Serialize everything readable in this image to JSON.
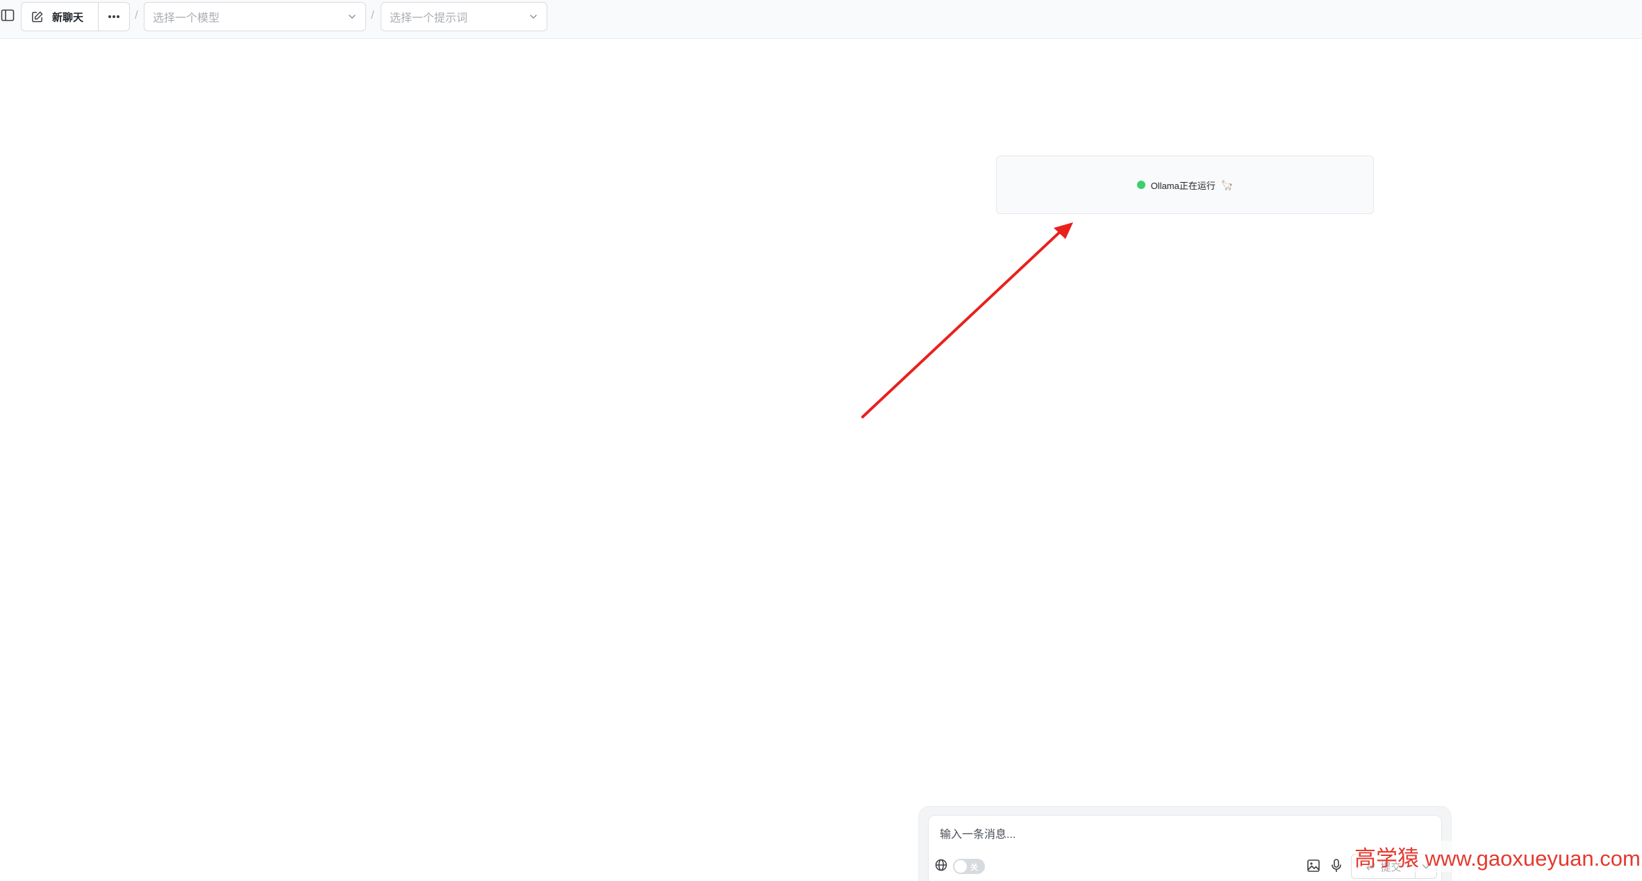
{
  "toolbar": {
    "new_chat_label": "新聊天",
    "separator": "/",
    "model_select": {
      "placeholder": "选择一个模型"
    },
    "prompt_select": {
      "placeholder": "选择一个提示词"
    }
  },
  "status": {
    "text": "Ollama正在运行",
    "emoji": "🦙",
    "dot_color": "#3ccf6e"
  },
  "composer": {
    "placeholder": "输入一条消息...",
    "web_search_toggle_label": "关",
    "web_search_enabled": false,
    "submit_label": "提交"
  },
  "watermark": {
    "text": "高学猿 www.gaoxueyuan.com"
  },
  "annotation": {
    "arrow_color": "#e8211d"
  },
  "icons": {
    "sidebar": "sidebar-toggle-icon",
    "new_chat": "edit-icon",
    "more": "more-horizontal-icon",
    "dropdown": "chevron-down-icon",
    "web_search": "globe-icon",
    "image": "image-icon",
    "mic": "microphone-icon",
    "submit": "enter-icon"
  }
}
